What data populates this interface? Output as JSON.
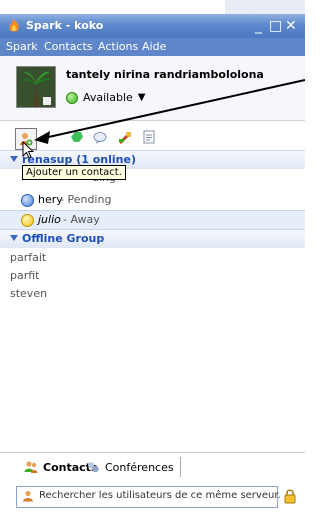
{
  "window": {
    "title": "Spark - koko"
  },
  "menu": [
    "Spark",
    "Contacts",
    "Actions",
    "Aide"
  ],
  "profile": {
    "name": "tantely nirina randriambololona",
    "status": "Available"
  },
  "tooltip": "Ajouter un contact.",
  "groups": {
    "online": {
      "label": "renasup (1 online)"
    },
    "offline": {
      "label": "Offline Group"
    }
  },
  "contacts": [
    {
      "name": "",
      "status": "ding"
    },
    {
      "name": "hery",
      "status": " - Pending"
    },
    {
      "name": "julio",
      "status": " - Away"
    }
  ],
  "offline_contacts": [
    "parfait",
    "parfit",
    "steven"
  ],
  "tabs": {
    "contacts": "Contacts",
    "conferences": "Conférences"
  },
  "search": {
    "text": "Rechercher les utilisateurs de ce même serveur."
  },
  "colors": {
    "titlebar": "#4a78c4",
    "group_text": "#1f4fb3"
  },
  "icons": [
    "spark-flame-icon",
    "add-contact-icon",
    "status-icon",
    "chat-icon",
    "tools-icon",
    "notes-icon",
    "lock-icon"
  ]
}
